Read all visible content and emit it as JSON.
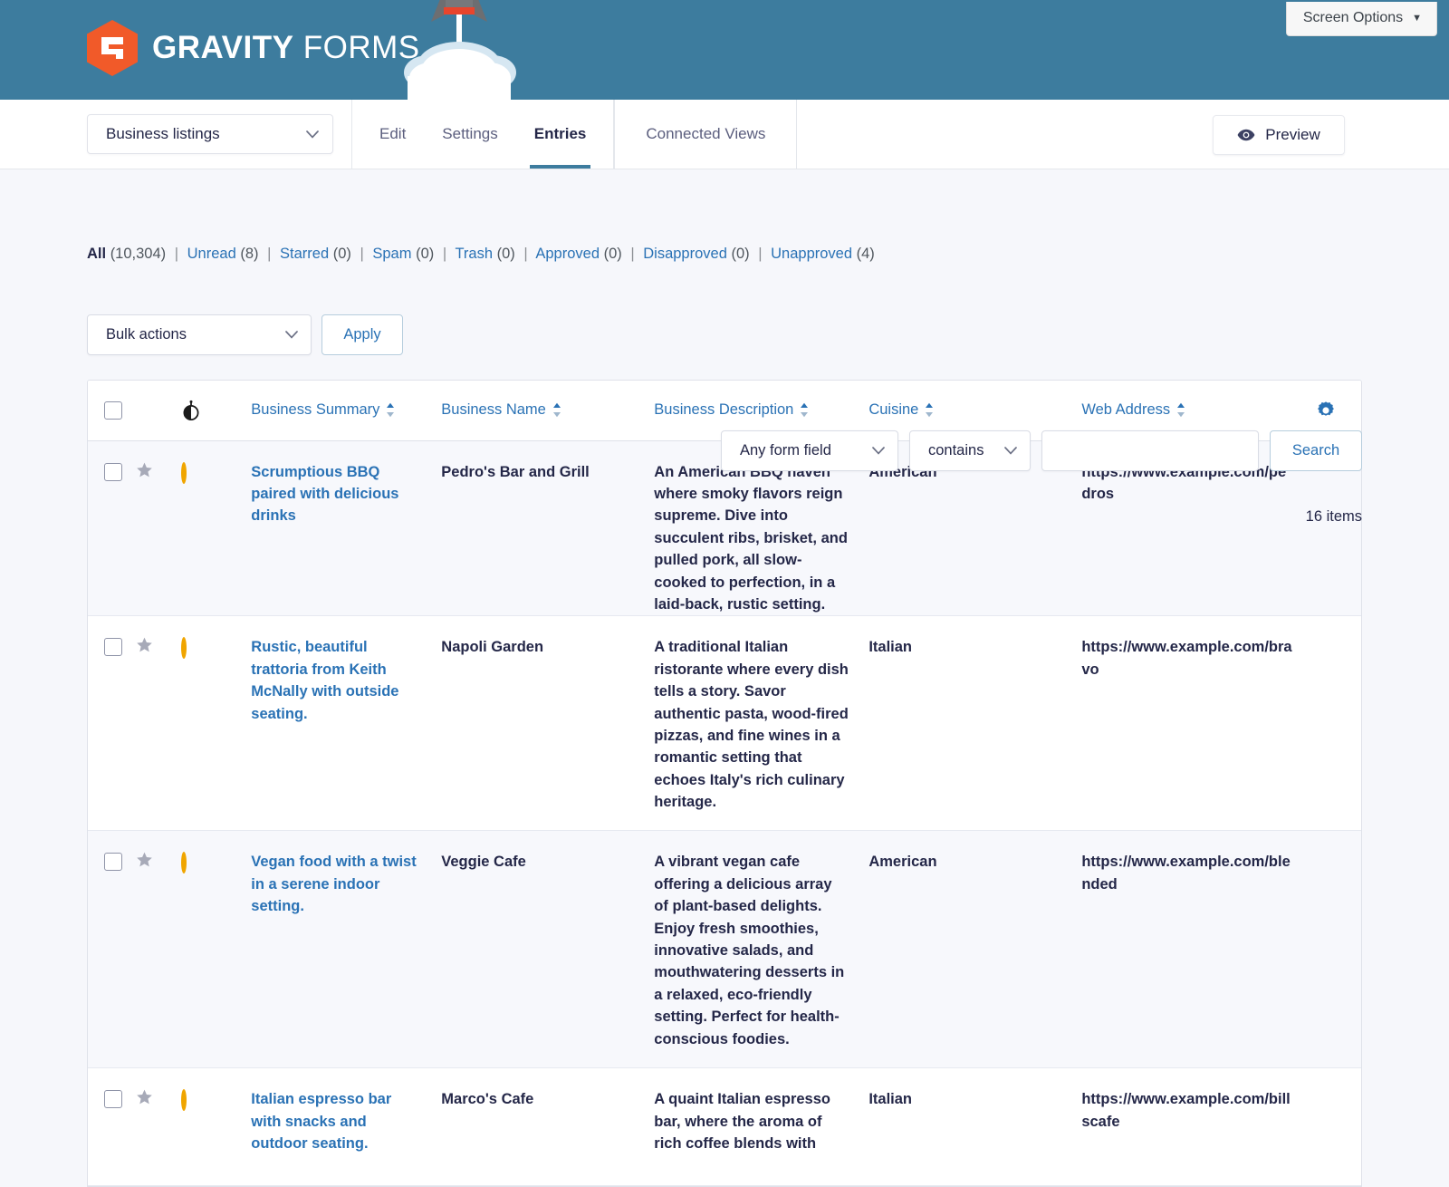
{
  "banner": {
    "brand_bold": "GRAVITY",
    "brand_light": "FORMS",
    "brand_color": "#f15a29",
    "bg_color": "#3d7c9e",
    "screen_options_label": "Screen Options",
    "screen_options_caret": "▼"
  },
  "toolbar": {
    "form_selector_value": "Business listings",
    "tabs": [
      {
        "label": "Edit",
        "active": false
      },
      {
        "label": "Settings",
        "active": false
      },
      {
        "label": "Entries",
        "active": true
      }
    ],
    "tabs_secondary": [
      {
        "label": "Connected Views",
        "active": false
      }
    ],
    "preview_label": "Preview"
  },
  "filters": [
    {
      "label": "All",
      "count": "(10,304)",
      "current": true
    },
    {
      "label": "Unread",
      "count": "(8)",
      "current": false
    },
    {
      "label": "Starred",
      "count": "(0)",
      "current": false
    },
    {
      "label": "Spam",
      "count": "(0)",
      "current": false
    },
    {
      "label": "Trash",
      "count": "(0)",
      "current": false
    },
    {
      "label": "Approved",
      "count": "(0)",
      "current": false
    },
    {
      "label": "Disapproved",
      "count": "(0)",
      "current": false
    },
    {
      "label": "Unapproved",
      "count": "(4)",
      "current": false
    }
  ],
  "search": {
    "field_select_value": "Any form field",
    "operator_select_value": "contains",
    "text_value": "",
    "text_placeholder": "",
    "search_button_label": "Search"
  },
  "bulk": {
    "select_value": "Bulk actions",
    "apply_label": "Apply",
    "items_count_label": "16 items"
  },
  "table": {
    "columns": [
      {
        "key": "checkbox",
        "label": "",
        "sortable": false
      },
      {
        "key": "star",
        "label": "",
        "sortable": false
      },
      {
        "key": "read",
        "label": "",
        "sortable": false
      },
      {
        "key": "summary",
        "label": "Business Summary",
        "sortable": true
      },
      {
        "key": "name",
        "label": "Business Name",
        "sortable": true
      },
      {
        "key": "description",
        "label": "Business Description",
        "sortable": true
      },
      {
        "key": "cuisine",
        "label": "Cuisine",
        "sortable": true
      },
      {
        "key": "web",
        "label": "Web Address",
        "sortable": true
      },
      {
        "key": "gear",
        "label": "",
        "sortable": false
      }
    ],
    "rows": [
      {
        "summary": "Scrumptious BBQ paired with delicious drinks",
        "name": "Pedro's Bar and Grill",
        "description": "An American BBQ haven where smoky flavors reign supreme. Dive into succulent ribs, brisket, and pulled pork, all slow-cooked to perfection, in a laid-back, rustic setting.",
        "cuisine": "American",
        "web": "https://www.example.com/pedros",
        "unread": true,
        "starred": false
      },
      {
        "summary": "Rustic, beautiful trattoria from Keith McNally with outside seating.",
        "name": "Napoli Garden",
        "description": "A traditional Italian ristorante where every dish tells a story. Savor authentic pasta, wood-fired pizzas, and fine wines in a romantic setting that echoes Italy's rich culinary heritage.",
        "cuisine": "Italian",
        "web": "https://www.example.com/bravo",
        "unread": true,
        "starred": false
      },
      {
        "summary": "Vegan food with a twist in a serene indoor setting.",
        "name": "Veggie Cafe",
        "description": "A vibrant vegan cafe offering a delicious array of plant-based delights. Enjoy fresh smoothies, innovative salads, and mouthwatering desserts in a relaxed, eco-friendly setting. Perfect for health-conscious foodies.",
        "cuisine": "American",
        "web": "https://www.example.com/blended",
        "unread": true,
        "starred": false
      },
      {
        "summary": "Italian espresso bar with snacks and outdoor seating.",
        "name": "Marco's Cafe",
        "description": "A quaint Italian espresso bar, where the aroma of rich coffee blends with",
        "cuisine": "Italian",
        "web": "https://www.example.com/billscafe",
        "unread": true,
        "starred": false
      }
    ]
  },
  "icons": {
    "chevron_down": "chevron-down-icon",
    "eye": "eye-icon",
    "gear": "gear-icon",
    "star": "star-icon",
    "unread_ring": "unread-indicator-icon",
    "read_status_header": "read-status-icon",
    "sort_arrows": "sort-arrows-icon"
  }
}
